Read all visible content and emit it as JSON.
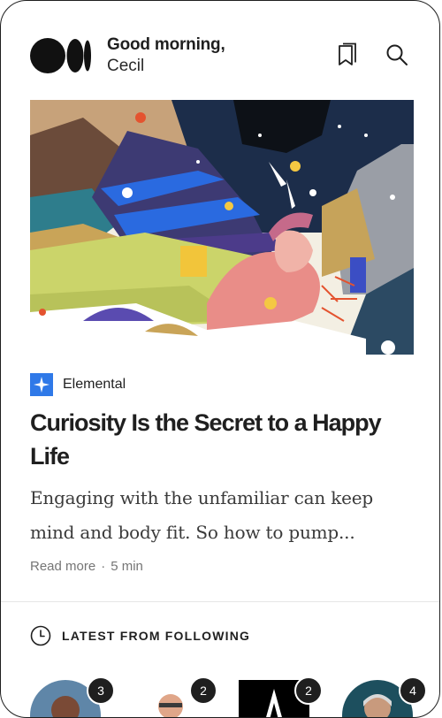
{
  "header": {
    "greeting_line1": "Good morning,",
    "greeting_name": "Cecil",
    "logo_icon": "medium-logo-icon",
    "bookmark_icon": "bookmark-icon",
    "search_icon": "search-icon"
  },
  "article": {
    "publication": "Elemental",
    "publication_color": "#2f79e8",
    "title": "Curiosity Is the Secret to a Happy Life",
    "snippet": "Engaging with the unfamiliar can keep mind and body fit. So how to pump...",
    "read_more": "Read more",
    "separator": "·",
    "read_time": "5 min"
  },
  "following": {
    "section_label": "LATEST FROM FOLLOWING",
    "section_icon": "clock-icon",
    "items": [
      {
        "badge": "3"
      },
      {
        "badge": "2"
      },
      {
        "badge": "2"
      },
      {
        "badge": "4"
      }
    ]
  }
}
